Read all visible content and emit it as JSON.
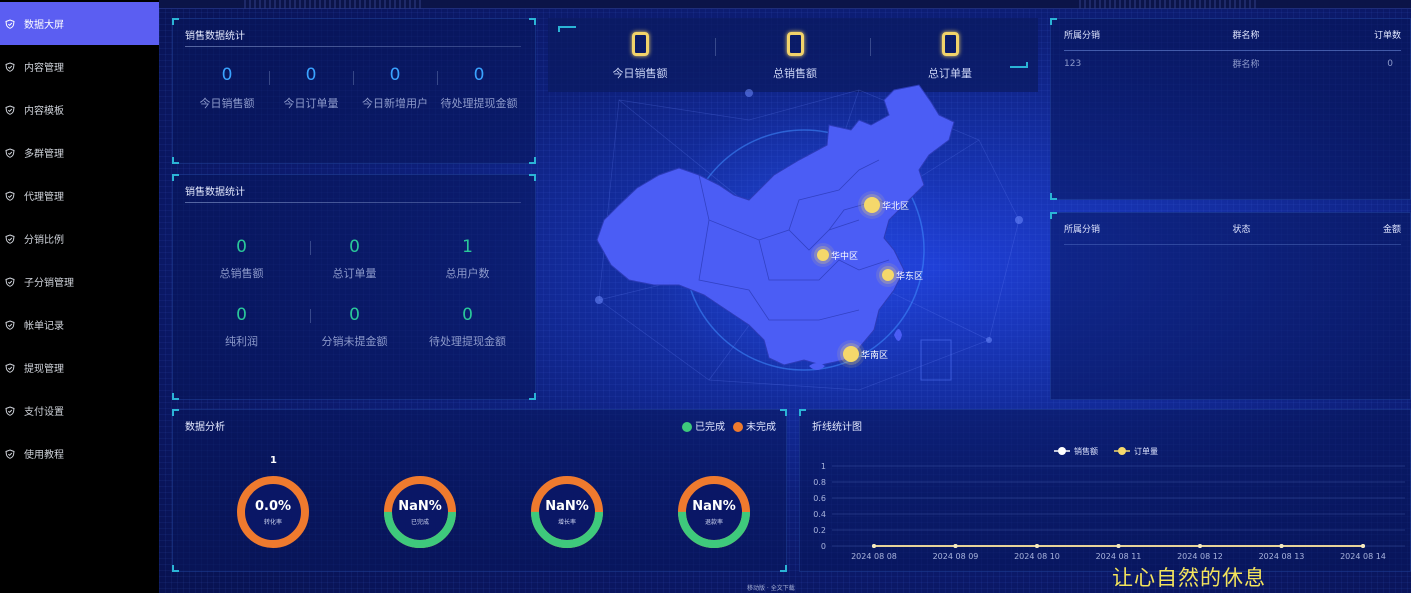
{
  "sidebar": {
    "items": [
      {
        "label": "数据大屏",
        "icon": "shield-check-icon",
        "active": true
      },
      {
        "label": "内容管理",
        "icon": "shield-check-icon"
      },
      {
        "label": "内容模板",
        "icon": "shield-check-icon"
      },
      {
        "label": "多群管理",
        "icon": "shield-check-icon"
      },
      {
        "label": "代理管理",
        "icon": "shield-check-icon"
      },
      {
        "label": "分销比例",
        "icon": "shield-check-icon"
      },
      {
        "label": "子分销管理",
        "icon": "shield-check-icon"
      },
      {
        "label": "帐单记录",
        "icon": "shield-check-icon"
      },
      {
        "label": "提现管理",
        "icon": "shield-check-icon"
      },
      {
        "label": "支付设置",
        "icon": "shield-check-icon"
      },
      {
        "label": "使用教程",
        "icon": "shield-check-icon"
      }
    ]
  },
  "panel_today": {
    "title": "销售数据统计",
    "stats": [
      {
        "value": "0",
        "label": "今日销售额"
      },
      {
        "value": "0",
        "label": "今日订单量"
      },
      {
        "value": "0",
        "label": "今日新增用户"
      },
      {
        "value": "0",
        "label": "待处理提现金额"
      }
    ]
  },
  "panel_total": {
    "title": "销售数据统计",
    "stats": [
      {
        "value": "0",
        "label": "总销售额"
      },
      {
        "value": "0",
        "label": "总订单量"
      },
      {
        "value": "1",
        "label": "总用户数"
      },
      {
        "value": "0",
        "label": "纯利润"
      },
      {
        "value": "0",
        "label": "分销未提金额"
      },
      {
        "value": "0",
        "label": "待处理提现金额"
      }
    ]
  },
  "kpis": [
    {
      "value": "0",
      "label": "今日销售额"
    },
    {
      "value": "0",
      "label": "总销售额"
    },
    {
      "value": "0",
      "label": "总订单量"
    }
  ],
  "map": {
    "regions": [
      {
        "label": "华北区"
      },
      {
        "label": "华中区"
      },
      {
        "label": "华东区"
      },
      {
        "label": "华南区"
      }
    ]
  },
  "group_table": {
    "headers": [
      "所属分销",
      "群名称",
      "订单数"
    ],
    "rows": [
      [
        "123",
        "群名称",
        "0"
      ]
    ]
  },
  "withdraw_table": {
    "headers": [
      "所属分销",
      "状态",
      "金额"
    ],
    "rows": []
  },
  "analysis": {
    "title": "数据分析",
    "legend": [
      {
        "label": "已完成",
        "color": "#3ec97c"
      },
      {
        "label": "未完成",
        "color": "#ef7a2e"
      }
    ],
    "top_value": "1",
    "donuts": [
      {
        "value": "0.0%",
        "label": "转化率",
        "completed_fraction": 0
      },
      {
        "value": "NaN%",
        "label": "已完成",
        "completed_fraction": 0.5
      },
      {
        "value": "NaN%",
        "label": "增长率",
        "completed_fraction": 0.5
      },
      {
        "value": "NaN%",
        "label": "退款率",
        "completed_fraction": 0.5
      }
    ]
  },
  "chart_data": {
    "type": "line",
    "title": "折线统计图",
    "x": [
      "2024 08 08",
      "2024 08 09",
      "2024 08 10",
      "2024 08 11",
      "2024 08 12",
      "2024 08 13",
      "2024 08 14"
    ],
    "series": [
      {
        "name": "销售额",
        "color": "#ffffff",
        "values": [
          0,
          0,
          0,
          0,
          0,
          0,
          0
        ]
      },
      {
        "name": "订单量",
        "color": "#f5d86b",
        "values": [
          0,
          0,
          0,
          0,
          0,
          0,
          0
        ]
      }
    ],
    "yticks": [
      "0",
      "0.2",
      "0.4",
      "0.6",
      "0.8",
      "1"
    ],
    "ylim": [
      0,
      1
    ],
    "grid": true,
    "legend": "top-center",
    "xlabel": "",
    "ylabel": ""
  },
  "footer": {
    "links": "移动版 · 全文下载",
    "caption": "让心自然的休息"
  }
}
